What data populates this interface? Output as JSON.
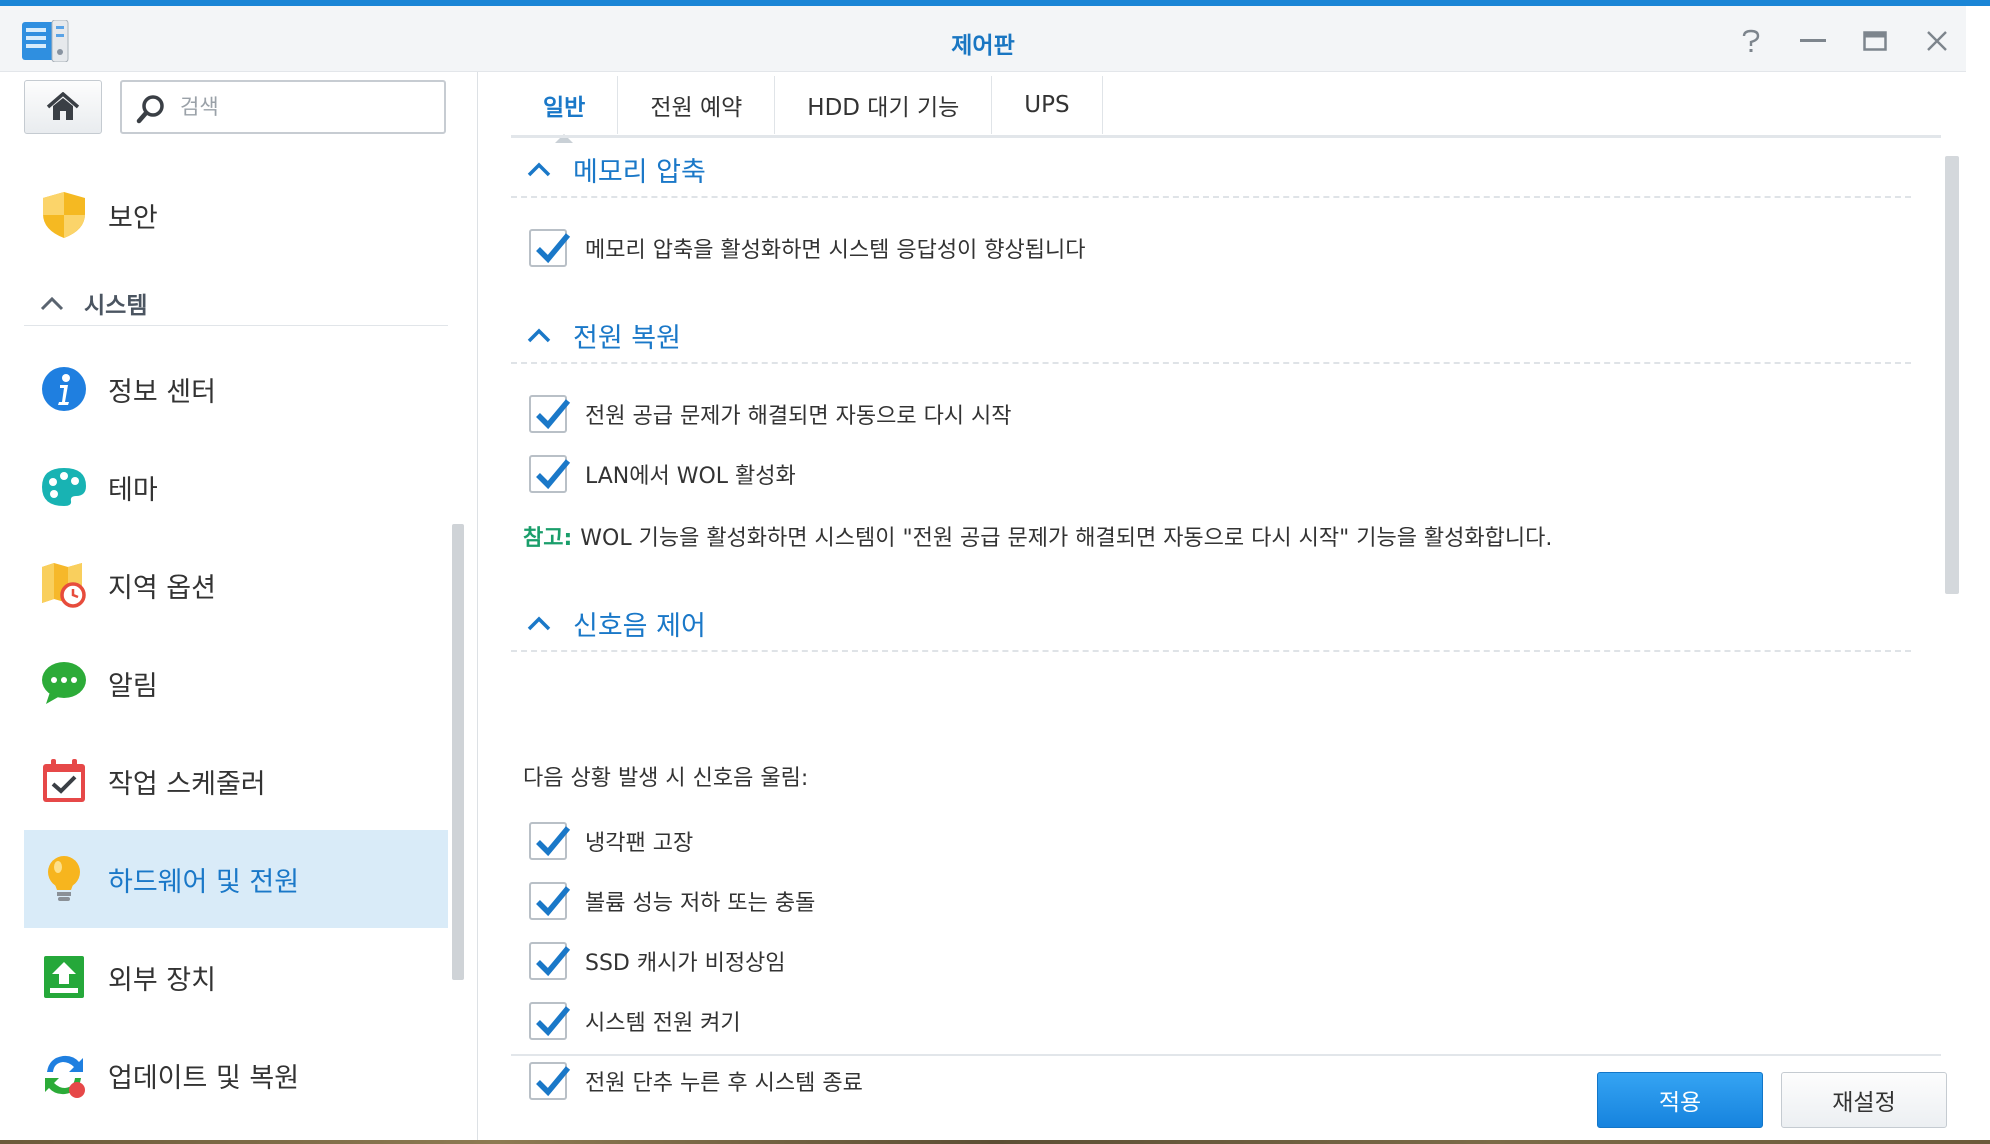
{
  "window": {
    "title": "제어판",
    "controls": {
      "help": "?",
      "minimize": "—",
      "maximize": "▭",
      "close": "✕"
    }
  },
  "sidebar": {
    "search_placeholder": "검색",
    "section_label": "시스템",
    "items": [
      {
        "label": "보안",
        "icon": "shield-icon"
      },
      {
        "label": "정보 센터",
        "icon": "info-icon"
      },
      {
        "label": "테마",
        "icon": "palette-icon"
      },
      {
        "label": "지역 옵션",
        "icon": "map-clock-icon"
      },
      {
        "label": "알림",
        "icon": "chat-bubble-icon"
      },
      {
        "label": "작업 스케줄러",
        "icon": "calendar-check-icon"
      },
      {
        "label": "하드웨어 및 전원",
        "icon": "lightbulb-icon",
        "active": true
      },
      {
        "label": "외부 장치",
        "icon": "upload-icon"
      },
      {
        "label": "업데이트 및 복원",
        "icon": "refresh-icon"
      }
    ]
  },
  "tabs": [
    "일반",
    "전원 예약",
    "HDD 대기 기능",
    "UPS"
  ],
  "sections": {
    "memory": {
      "title": "메모리 압축",
      "options": [
        "메모리 압축을 활성화하면 시스템 응답성이 향상됩니다"
      ]
    },
    "power": {
      "title": "전원 복원",
      "options": [
        "전원 공급 문제가 해결되면 자동으로 다시 시작",
        "LAN에서 WOL 활성화"
      ],
      "note_key": "참고:",
      "note_text": "WOL 기능을 활성화하면 시스템이 \"전원 공급 문제가 해결되면 자동으로 다시 시작\" 기능을 활성화합니다."
    },
    "beep": {
      "title": "신호음 제어",
      "intro": "다음 상황 발생 시 신호음 울림:",
      "options": [
        "냉각팬 고장",
        "볼륨 성능 저하 또는 충돌",
        "SSD 캐시가 비정상임",
        "시스템 전원 켜기",
        "전원 단추 누른 후 시스템 종료"
      ]
    }
  },
  "buttons": {
    "apply": "적용",
    "reset": "재설정"
  },
  "colors": {
    "accent": "#1a78c8",
    "note": "#1a9e6b",
    "active_bg": "#d9ebf8"
  }
}
